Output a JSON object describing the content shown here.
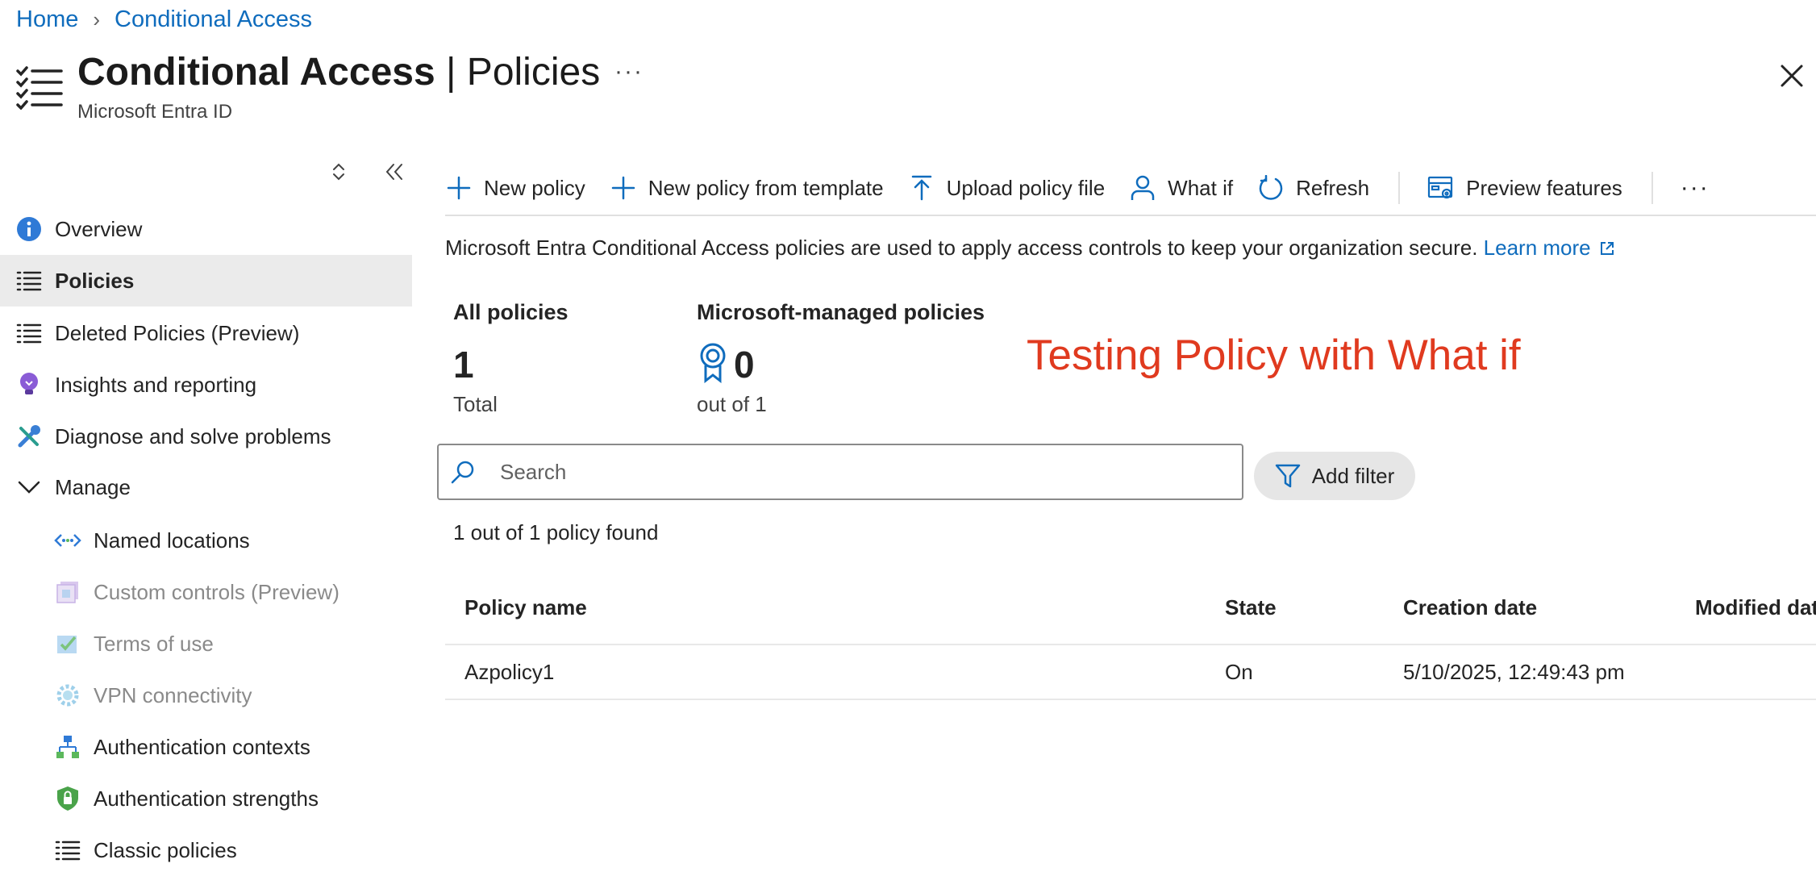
{
  "breadcrumb": [
    {
      "label": "Home"
    },
    {
      "label": "Conditional Access"
    }
  ],
  "header": {
    "title_bold": "Conditional Access",
    "title_rest": " | Policies",
    "subtitle": "Microsoft Entra ID",
    "more": "···"
  },
  "sidebar": {
    "items": [
      {
        "label": "Overview",
        "icon": "info-icon"
      },
      {
        "label": "Policies",
        "icon": "list-icon",
        "active": true
      },
      {
        "label": "Deleted Policies (Preview)",
        "icon": "list-icon"
      },
      {
        "label": "Insights and reporting",
        "icon": "lightbulb-icon"
      },
      {
        "label": "Diagnose and solve problems",
        "icon": "wrench-icon"
      },
      {
        "label": "Manage",
        "icon": "chevron-down-icon"
      },
      {
        "label": "Named locations",
        "icon": "network-icon"
      },
      {
        "label": "Custom controls (Preview)",
        "icon": "custom-controls-icon"
      },
      {
        "label": "Terms of use",
        "icon": "terms-icon"
      },
      {
        "label": "VPN connectivity",
        "icon": "gear-icon"
      },
      {
        "label": "Authentication contexts",
        "icon": "hierarchy-icon"
      },
      {
        "label": "Authentication strengths",
        "icon": "shield-lock-icon"
      },
      {
        "label": "Classic policies",
        "icon": "list-icon"
      }
    ]
  },
  "toolbar": {
    "new_policy": "New policy",
    "new_from_template": "New policy from template",
    "upload": "Upload policy file",
    "what_if": "What if",
    "refresh": "Refresh",
    "preview_features": "Preview features",
    "more": "···"
  },
  "description": {
    "text": "Microsoft Entra Conditional Access policies are used to apply access controls to keep your organization secure.",
    "link": "Learn more"
  },
  "summary": {
    "all_label": "All policies",
    "all_value": "1",
    "all_sub": "Total",
    "managed_label": "Microsoft-managed policies",
    "managed_value": "0",
    "managed_sub": "out of 1"
  },
  "annotation": "Testing Policy with What if",
  "search": {
    "placeholder": "Search"
  },
  "filter": {
    "label": "Add filter"
  },
  "result_count": "1 out of 1 policy found",
  "table": {
    "columns": [
      "Policy name",
      "State",
      "Creation date",
      "Modified dat"
    ],
    "rows": [
      {
        "name": "Azpolicy1",
        "state": "On",
        "created": "5/10/2025, 12:49:43 pm",
        "modified": ""
      }
    ]
  },
  "colors": {
    "accent": "#0f6cbd",
    "annotation": "#e03a1f",
    "active_bg": "#ebebeb"
  }
}
